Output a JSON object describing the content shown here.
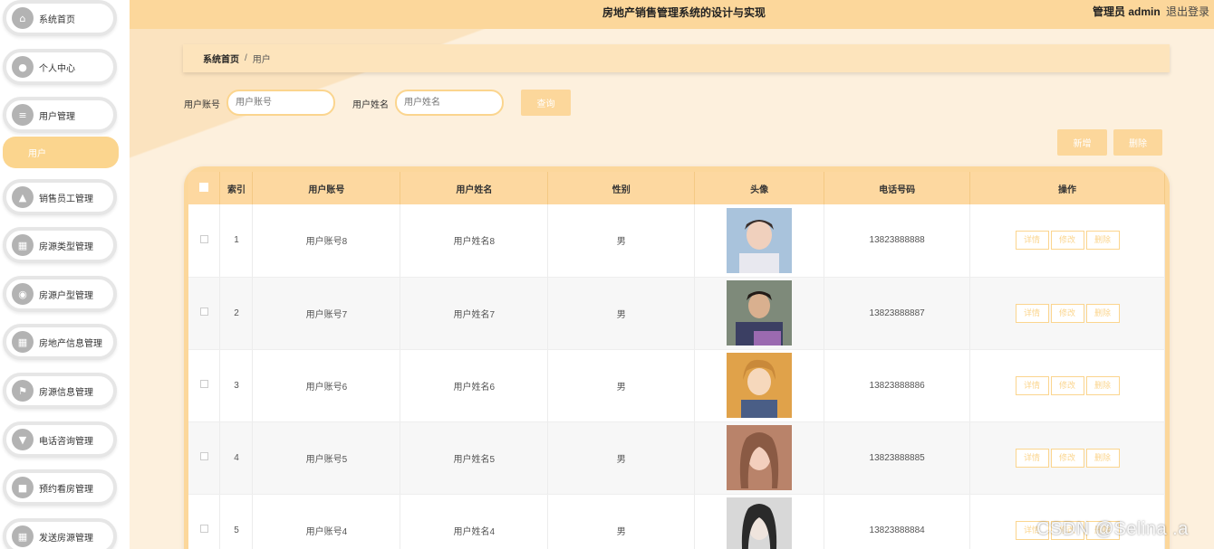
{
  "header": {
    "title": "房地产销售管理系统的设计与实现",
    "admin": "管理员 admin",
    "logout": "退出登录"
  },
  "sidebar": {
    "items": [
      {
        "label": "系统首页",
        "icon": "home-icon"
      },
      {
        "label": "个人中心",
        "icon": "person-icon"
      },
      {
        "label": "用户管理",
        "icon": "list-icon"
      },
      {
        "label": "销售员工管理",
        "icon": "thumb-icon"
      },
      {
        "label": "房源类型管理",
        "icon": "grid-icon"
      },
      {
        "label": "房源户型管理",
        "icon": "pin-icon"
      },
      {
        "label": "房地产信息管理",
        "icon": "grid-icon"
      },
      {
        "label": "房源信息管理",
        "icon": "flag-icon"
      },
      {
        "label": "电话咨询管理",
        "icon": "comment-icon"
      },
      {
        "label": "预约看房管理",
        "icon": "chat-icon"
      },
      {
        "label": "发送房源管理",
        "icon": "grid-icon"
      }
    ],
    "sub_active": "用户"
  },
  "breadcrumb": {
    "home": "系统首页",
    "sep": "/",
    "current": "用户"
  },
  "search": {
    "account_label": "用户账号",
    "account_placeholder": "用户账号",
    "name_label": "用户姓名",
    "name_placeholder": "用户姓名",
    "query_button": "查询"
  },
  "actions": {
    "add": "新增",
    "delete": "删除"
  },
  "table": {
    "headers": [
      "索引",
      "用户账号",
      "用户姓名",
      "性别",
      "头像",
      "电话号码",
      "操作"
    ],
    "ops": {
      "detail": "详情",
      "edit": "修改",
      "delete": "删除"
    },
    "rows": [
      {
        "index": "1",
        "account": "用户账号8",
        "name": "用户姓名8",
        "gender": "男",
        "phone": "13823888888"
      },
      {
        "index": "2",
        "account": "用户账号7",
        "name": "用户姓名7",
        "gender": "男",
        "phone": "13823888887"
      },
      {
        "index": "3",
        "account": "用户账号6",
        "name": "用户姓名6",
        "gender": "男",
        "phone": "13823888886"
      },
      {
        "index": "4",
        "account": "用户账号5",
        "name": "用户姓名5",
        "gender": "男",
        "phone": "13823888885"
      },
      {
        "index": "5",
        "account": "用户账号4",
        "name": "用户姓名4",
        "gender": "男",
        "phone": "13823888884"
      }
    ]
  },
  "watermark": "CSDN @Selina .a",
  "colors": {
    "accent": "#fcd79b",
    "accent_dark": "#fbd58e",
    "sidebar_icon": "#b3b3b3"
  }
}
